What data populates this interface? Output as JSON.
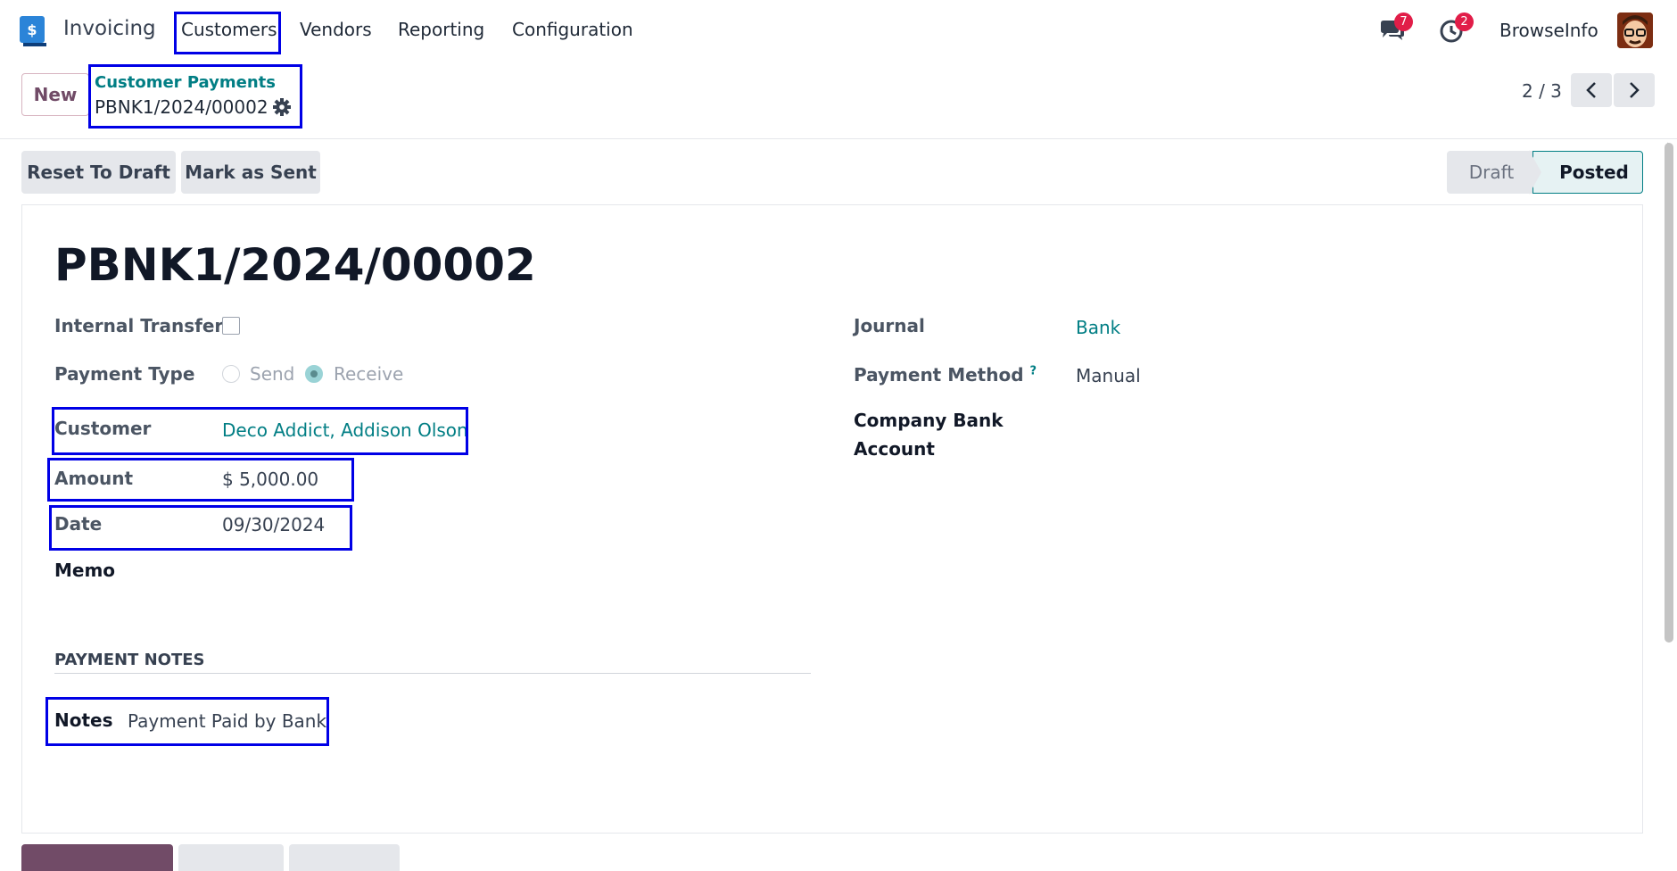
{
  "navbar": {
    "app_name": "Invoicing",
    "menu": [
      "Customers",
      "Vendors",
      "Reporting",
      "Configuration"
    ],
    "messages_count": "7",
    "activities_count": "2",
    "user_name": "BrowseInfo"
  },
  "control": {
    "new_label": "New",
    "breadcrumb_parent": "Customer Payments",
    "breadcrumb_current": "PBNK1/2024/00002",
    "pager": "2 / 3"
  },
  "statusbar": {
    "reset_label": "Reset To Draft",
    "mark_sent_label": "Mark as Sent",
    "stages": [
      "Draft",
      "Posted"
    ],
    "active_stage": "Posted"
  },
  "form": {
    "title": "PBNK1/2024/00002",
    "internal_transfer_label": "Internal Transfer",
    "payment_type_label": "Payment Type",
    "payment_type_options": [
      "Send",
      "Receive"
    ],
    "payment_type_selected": "Receive",
    "customer_label": "Customer",
    "customer_value": "Deco Addict, Addison Olson",
    "amount_label": "Amount",
    "amount_value": "$ 5,000.00",
    "date_label": "Date",
    "date_value": "09/30/2024",
    "memo_label": "Memo",
    "journal_label": "Journal",
    "journal_value": "Bank",
    "payment_method_label": "Payment Method",
    "payment_method_help": "?",
    "payment_method_value": "Manual",
    "company_bank_label_1": "Company Bank",
    "company_bank_label_2": "Account",
    "section_payment_notes": "PAYMENT NOTES",
    "notes_label": "Notes",
    "notes_value": "Payment Paid by Bank"
  },
  "colors": {
    "accent": "#017e84",
    "brand": "#714b67",
    "highlight": "#0000e6",
    "badge": "#e11d48"
  }
}
